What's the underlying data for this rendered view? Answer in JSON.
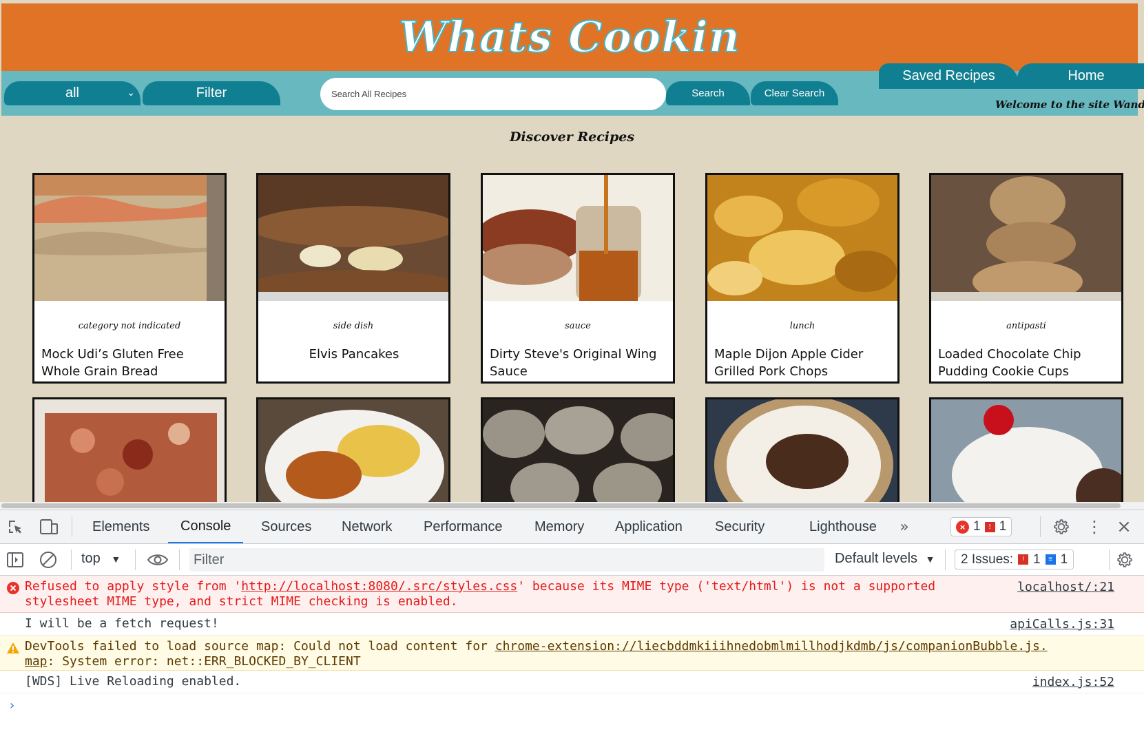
{
  "site": {
    "title": "Whats Cookin",
    "nav": {
      "category_value": "all",
      "filter_label": "Filter",
      "search_placeholder": "Search All Recipes",
      "search_label": "Search",
      "clear_search_label": "Clear Search",
      "saved_recipes_label": "Saved Recipes",
      "home_label": "Home",
      "welcome": "Welcome to the site Wanda Stan"
    },
    "discover_title": "Discover Recipes",
    "recipes": [
      {
        "category": "category not indicated",
        "name": "Mock Udi’s Gluten Free Whole Grain Bread",
        "image": "bread-photo"
      },
      {
        "category": "side dish",
        "name": "Elvis Pancakes",
        "image": "pancakes-photo"
      },
      {
        "category": "sauce",
        "name": "Dirty Steve's Original Wing Sauce",
        "image": "sauce-jar-photo"
      },
      {
        "category": "lunch",
        "name": "Maple Dijon Apple Cider Grilled Pork Chops",
        "image": "pork-chops-photo"
      },
      {
        "category": "antipasti",
        "name": "Loaded Chocolate Chip Pudding Cookie Cups",
        "image": "cookie-stack-photo"
      }
    ],
    "recipes_row2_images": [
      "pizza-casserole-photo",
      "chicken-slaw-photo",
      "cookies-rack-photo",
      "chocolate-tart-photo",
      "ice-cream-cherry-photo"
    ],
    "colors": {
      "header_orange": "#e07326",
      "nav_teal": "#67b8bf",
      "button_teal": "#117f92",
      "page_bg": "#dfd7c2"
    }
  },
  "devtools": {
    "tabs": [
      "Elements",
      "Console",
      "Sources",
      "Network",
      "Performance",
      "Memory",
      "Application",
      "Security",
      "Lighthouse"
    ],
    "active_tab": "Console",
    "error_count": "1",
    "issue_flag_count": "1",
    "context": "top",
    "filter_placeholder": "Filter",
    "levels": "Default levels",
    "issues_label": "2 Issues:",
    "issues_error_count": "1",
    "issues_info_count": "1",
    "messages": [
      {
        "level": "error",
        "line1_prefix": "Refused to apply style from '",
        "line1_link": "http://localhost:8080/.src/styles.css",
        "line1_suffix": "' because its MIME type ('text/html') is not a supported",
        "line2": "stylesheet MIME type, and strict MIME checking is enabled.",
        "source": "localhost/:21"
      },
      {
        "level": "info",
        "text": "I will be a fetch request!",
        "source": "apiCalls.js:31"
      },
      {
        "level": "warning",
        "line1_prefix": "DevTools failed to load source map: Could not load content for ",
        "line1_link": "chrome-extension://liecbddmkiiihnedobmlmillhodjkdmb/js/companionBubble.js.",
        "line2_link": "map",
        "line2_suffix": ": System error: net::ERR_BLOCKED_BY_CLIENT"
      },
      {
        "level": "info",
        "text": "[WDS] Live Reloading enabled.",
        "source": "index.js:52"
      }
    ]
  }
}
